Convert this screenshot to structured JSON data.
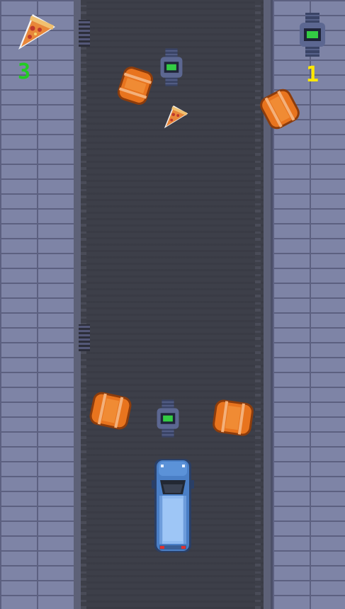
{
  "hud": {
    "pizza_count": "3",
    "watch_count": "1",
    "pizza_icon": "pizza-slice-icon",
    "watch_icon": "digital-watch-icon"
  },
  "colors": {
    "pizza_counter": "#22cc22",
    "watch_counter": "#ffe800",
    "road": "#3d3f49",
    "brick": "#7e84a6",
    "barrel": "#e8741e",
    "car": "#4a7fc6"
  },
  "sprites": {
    "barrels": 4,
    "watches": 2,
    "pizza_slices": 1,
    "player_car": "blue-suv"
  }
}
